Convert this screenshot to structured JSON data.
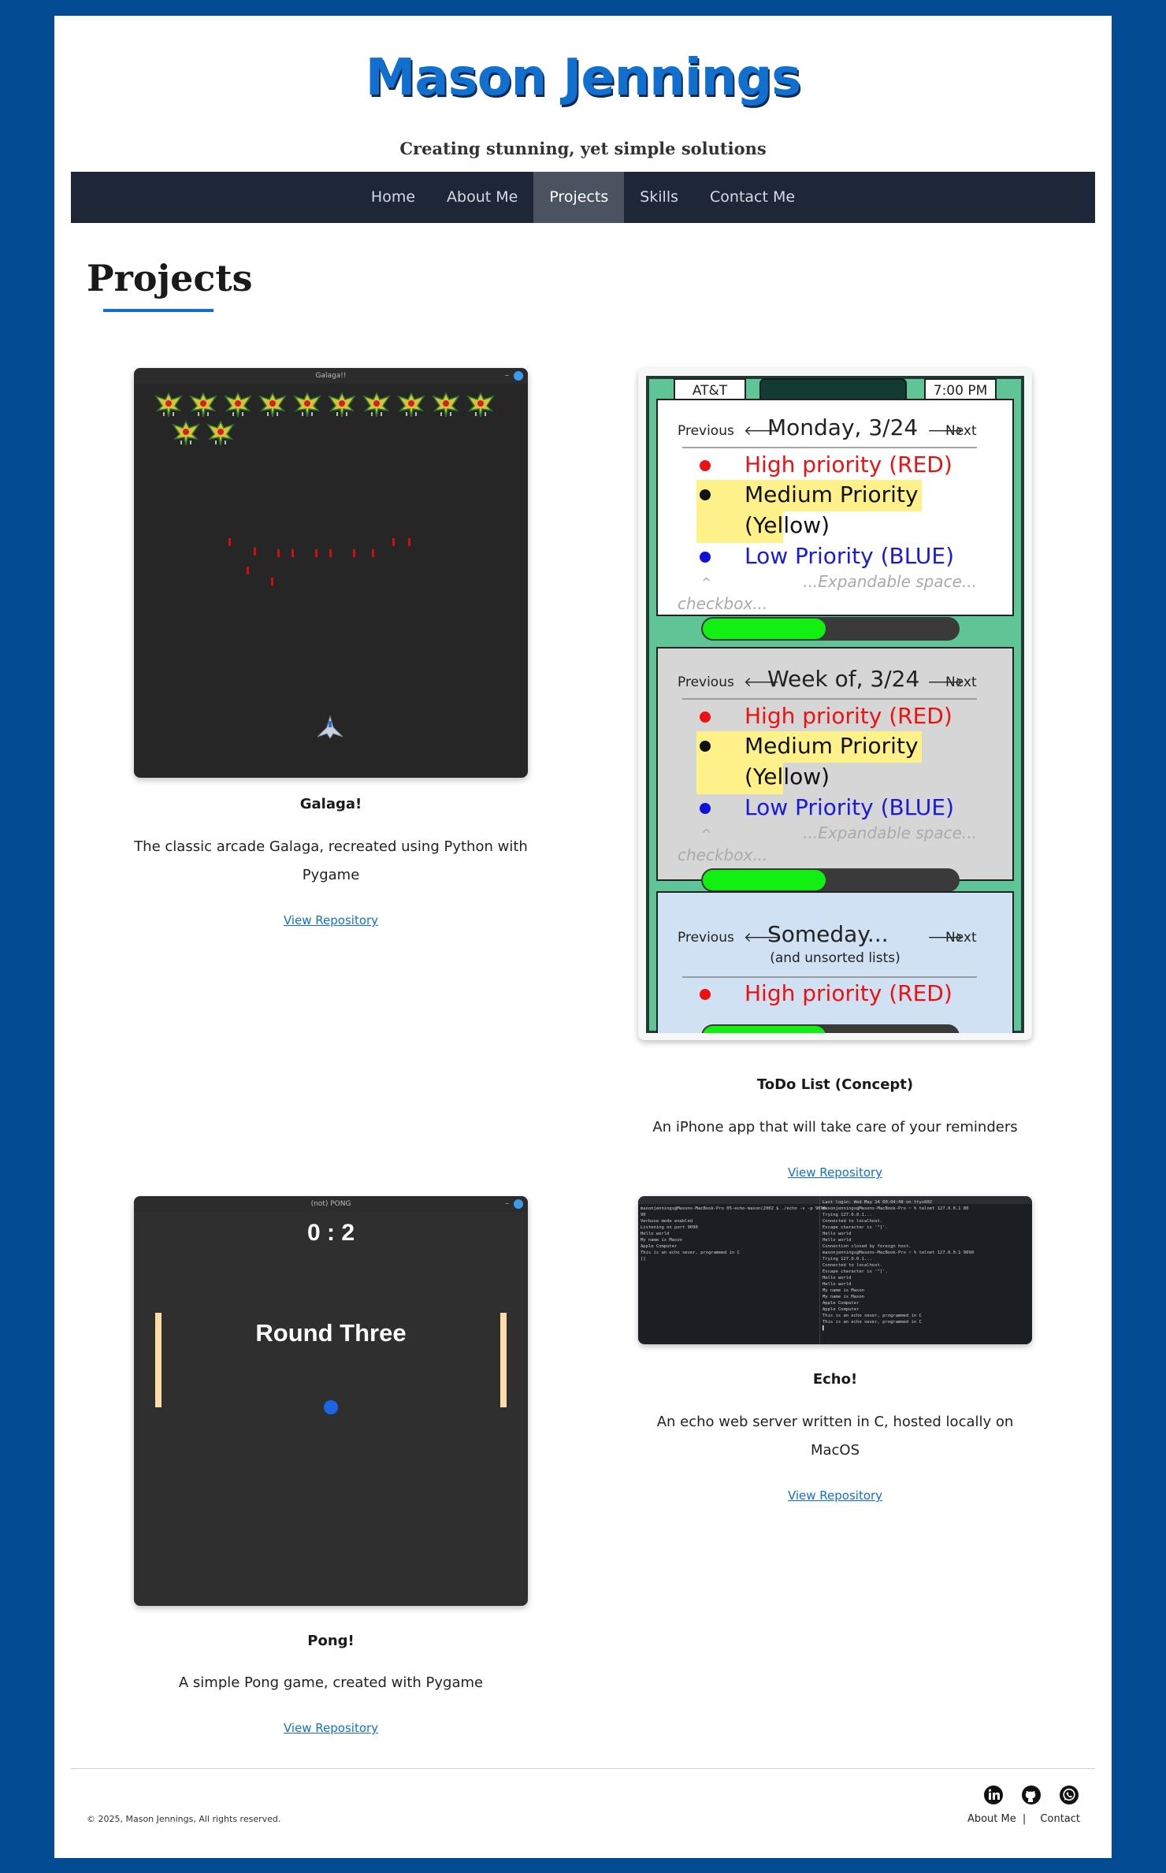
{
  "header": {
    "title": "Mason Jennings",
    "tagline": "Creating stunning, yet simple solutions"
  },
  "nav": {
    "items": [
      "Home",
      "About Me",
      "Projects",
      "Skills",
      "Contact Me"
    ],
    "active": "Projects"
  },
  "section": {
    "title": "Projects"
  },
  "projects": [
    {
      "title": "Galaga!",
      "description": "The classic arcade Galaga, recreated using Python with Pygame",
      "link": "View Repository",
      "window_title": "Galaga!!"
    },
    {
      "title": "ToDo List (Concept)",
      "description": "An iPhone app that will take care of your reminders",
      "link": "View Repository",
      "mock": {
        "carrier": "AT&T",
        "time": "7:00 PM",
        "sections": [
          {
            "prev": "Previous",
            "heading": "Monday, 3/24",
            "next": "Next",
            "items": [
              "High priority (RED)",
              "Medium Priority",
              "(Yellow)",
              "Low Priority (BLUE)"
            ],
            "expand": "...Expandable space...",
            "caret": "^",
            "checkbox": "checkbox..."
          },
          {
            "prev": "Previous",
            "heading": "Week of, 3/24",
            "next": "Next",
            "items": [
              "High priority (RED)",
              "Medium Priority",
              "(Yellow)",
              "Low Priority (BLUE)"
            ],
            "expand": "...Expandable space...",
            "caret": "^",
            "checkbox": "checkbox..."
          },
          {
            "prev": "Previous",
            "heading": "Someday...",
            "sub": "(and unsorted lists)",
            "next": "Next",
            "items": [
              "High priority (RED)"
            ],
            "more": "..."
          }
        ]
      }
    },
    {
      "title": "Pong!",
      "description": "A simple Pong game, created with Pygame",
      "link": "View Repository",
      "window_title": "(not) PONG",
      "score": "0 : 2",
      "round": "Round Three"
    },
    {
      "title": "Echo!",
      "description": "An echo web server written in C, hosted locally on MacOS",
      "link": "View Repository",
      "left_terminal": "masonjennings@Masons-MacBook-Pro 05-echo-mason(2002 $ ./echo -v -p 9090\n90\nVerbose mode enabled\nListening on port 9090\nHello world\nMy name is Mason\nApple Computer\nThis is an echo sever, programmed in C\n[]",
      "right_terminal": "Last login: Wed May 14 00:04:48 on ttys002\nmasonjennings@Masons-MacBook-Pro ~ % telnet 127.0.0.1 80\nTrying 127.0.0.1...\nConnected to localhost.\nEscape character is '^]'.\nHello world\nHello world\nConnection closed by foreign host.\nmasonjennings@Masons-MacBook-Pro ~ % telnet 127.0.0.1 9090\nTrying 127.0.0.1...\nConnected to localhost.\nEscape character is '^]'.\nHello world\nHello world\nMy name is Mason\nMy name is Mason\nApple Computer\nApple Computer\nThis is an echo sever, programmed in C\nThis is an echo sever, programmed in C\n▌"
    }
  ],
  "footer": {
    "copyright": "© 2025, Mason Jennings, All rights reserved.",
    "links": [
      "About Me",
      "Contact"
    ],
    "separator": "|",
    "social_icons": [
      "linkedin-icon",
      "github-icon",
      "whatsapp-icon"
    ]
  },
  "colors": {
    "background": "#034c94",
    "accent": "#1170cf",
    "nav": "#1e2738",
    "nav_active": "#4b5361"
  }
}
